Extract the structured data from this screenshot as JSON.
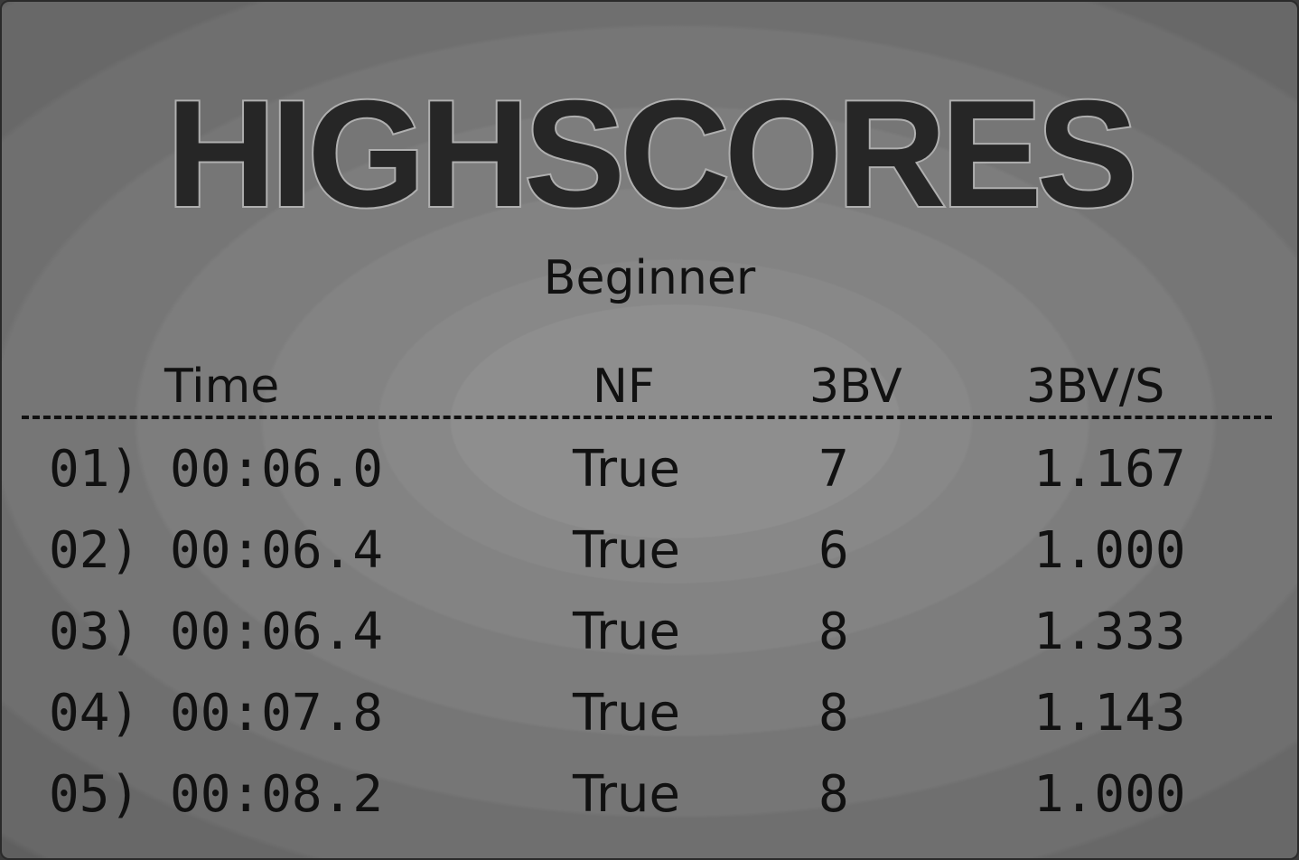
{
  "title": "HIGHSCORES",
  "difficulty": "Beginner",
  "columns": {
    "time": "Time",
    "nf": "NF",
    "bv": "3BV",
    "bvs": "3BV/S"
  },
  "rows": [
    {
      "rank": "01)",
      "time": "00:06.0",
      "nf": "True",
      "bv": "7",
      "bvs": "1.167"
    },
    {
      "rank": "02)",
      "time": "00:06.4",
      "nf": "True",
      "bv": "6",
      "bvs": "1.000"
    },
    {
      "rank": "03)",
      "time": "00:06.4",
      "nf": "True",
      "bv": "8",
      "bvs": "1.333"
    },
    {
      "rank": "04)",
      "time": "00:07.8",
      "nf": "True",
      "bv": "8",
      "bvs": "1.143"
    },
    {
      "rank": "05)",
      "time": "00:08.2",
      "nf": "True",
      "bv": "8",
      "bvs": "1.000"
    }
  ]
}
